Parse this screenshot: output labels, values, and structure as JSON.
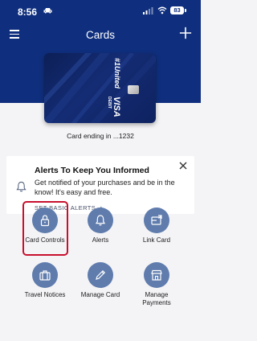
{
  "status_bar": {
    "time": "8:56",
    "battery": "83"
  },
  "nav": {
    "title": "Cards",
    "menu_icon": "hamburger-menu-icon",
    "add_icon": "plus-icon"
  },
  "card": {
    "brand_logo": "#1United",
    "network": "VISA",
    "card_kind": "DEBIT",
    "caption": "Card ending in ...1232"
  },
  "alert_panel": {
    "heading": "Alerts To Keep You Informed",
    "body": "Get notified of your purchases and be in the know! It's easy and free.",
    "link": "SET BASIC ALERTS",
    "link_chevron": "›",
    "icon": "bell-icon",
    "close_icon": "close-icon"
  },
  "actions": [
    {
      "label": "Card Controls",
      "icon": "lock-icon",
      "highlighted": true
    },
    {
      "label": "Alerts",
      "icon": "bell-icon"
    },
    {
      "label": "Link Card",
      "icon": "link-card-icon"
    },
    {
      "label": "Travel Notices",
      "icon": "suitcase-icon"
    },
    {
      "label": "Manage Card",
      "icon": "pencil-icon"
    },
    {
      "label": "Manage Payments",
      "icon": "storefront-icon"
    }
  ],
  "colors": {
    "header_blue": "#0f2f7e",
    "action_circle": "#5f7cad",
    "highlight_red": "#c8102e",
    "background": "#f4f4f6"
  }
}
